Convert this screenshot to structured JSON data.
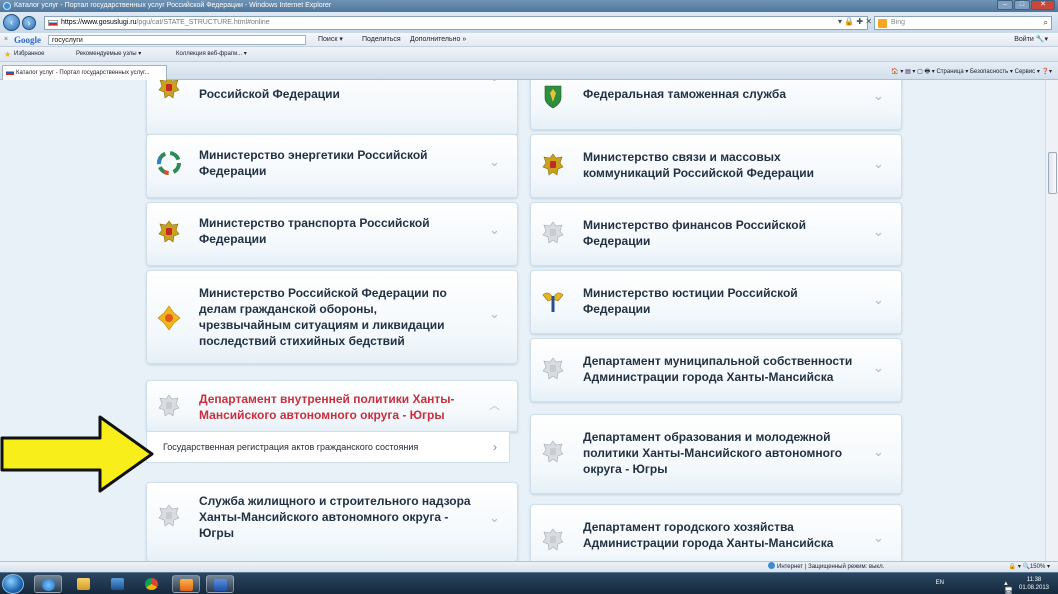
{
  "window": {
    "title": "Каталог услуг - Портал государственных услуг Российской Федерации - Windows Internet Explorer",
    "controls": {
      "minimize": "–",
      "maximize": "□",
      "close": "✕"
    }
  },
  "address_bar": {
    "url_host": "https://www.gosuslugi.ru",
    "url_rest": "/pgu/cat/STATE_STRUCTURE.html#online",
    "tools": "▾ 🔒 ✚ ✕",
    "search_provider": "Bing",
    "search_icon": "⌕",
    "nav_back": "‹",
    "nav_forward": "›"
  },
  "google_toolbar": {
    "close": "×",
    "logo": "Google",
    "query": "госуслуги",
    "search_btn": "Поиск ▾",
    "share_btn": "Поделиться",
    "more_btn": "Дополнительно »",
    "signin": "Войти 🔧▾"
  },
  "favorites_bar": {
    "favorites": "Избранное",
    "suggested": "Рекомендуемые узлы ▾",
    "gallery": "Коллекция веб-фрагм... ▾"
  },
  "tab": {
    "label": "Каталог услуг - Портал государственных услуг..."
  },
  "command_bar": {
    "items": "🏠 ▾ ▤ ▾ ▢ 🖶 ▾ Страница ▾ Безопасность ▾ Сервис ▾ ❓▾"
  },
  "left_cards": [
    {
      "title": "Российской Федерации",
      "emblem": "russia-coat-of-arms-icon",
      "state": "collapsed"
    },
    {
      "title": "Министерство энергетики Российской Федерации",
      "emblem": "ministry-energy-logo-icon",
      "state": "collapsed"
    },
    {
      "title": "Министерство транспорта Российской Федерации",
      "emblem": "russia-coat-of-arms-icon",
      "state": "collapsed"
    },
    {
      "title": "Министерство Российской Федерации по делам гражданской обороны, чрезвычайным ситуациям и ликвидации последствий стихийных бедствий",
      "emblem": "emercom-emblem-icon",
      "state": "collapsed"
    },
    {
      "title": "Департамент внутренней политики Ханты-Мансийского автономного округа - Югры",
      "emblem": "grey-coat-of-arms-icon",
      "state": "expanded"
    },
    {
      "title": "Служба жилищного и строительного надзора Ханты-Мансийского автономного округа - Югры",
      "emblem": "grey-coat-of-arms-icon",
      "state": "collapsed"
    }
  ],
  "expanded_subitem": {
    "label": "Государственная регистрация актов гражданского состояния"
  },
  "right_cards": [
    {
      "title": "Федеральная таможенная служба",
      "emblem": "customs-emblem-icon",
      "state": "collapsed"
    },
    {
      "title": "Министерство связи и массовых коммуникаций Российской Федерации",
      "emblem": "russia-coat-of-arms-icon",
      "state": "collapsed"
    },
    {
      "title": "Министерство финансов Российской Федерации",
      "emblem": "grey-coat-of-arms-icon",
      "state": "collapsed"
    },
    {
      "title": "Министерство юстиции Российской Федерации",
      "emblem": "justice-emblem-icon",
      "state": "collapsed"
    },
    {
      "title": "Департамент муниципальной собственности Администрации города Ханты-Мансийска",
      "emblem": "grey-coat-of-arms-icon",
      "state": "collapsed"
    },
    {
      "title": "Департамент образования и молодежной политики Ханты-Мансийского автономного округа - Югры",
      "emblem": "grey-coat-of-arms-icon",
      "state": "collapsed"
    },
    {
      "title": "Департамент городского хозяйства Администрации города Ханты-Мансийска",
      "emblem": "grey-coat-of-arms-icon",
      "state": "collapsed"
    }
  ],
  "status_bar": {
    "zone": "Интернет | Защищенный режим: выкл.",
    "zoom": "🔒 ▾ 🔍150% ▾"
  },
  "taskbar": {
    "lang": "EN",
    "tray_icons": "▴ 🖥 🏁 🔊",
    "time": "11:38",
    "date": "01.08.2013"
  },
  "colors": {
    "accent_red": "#c7303c",
    "card_text": "#233243",
    "page_bg": "#e8f1f7",
    "pointer_arrow": "#f7ee1a"
  }
}
